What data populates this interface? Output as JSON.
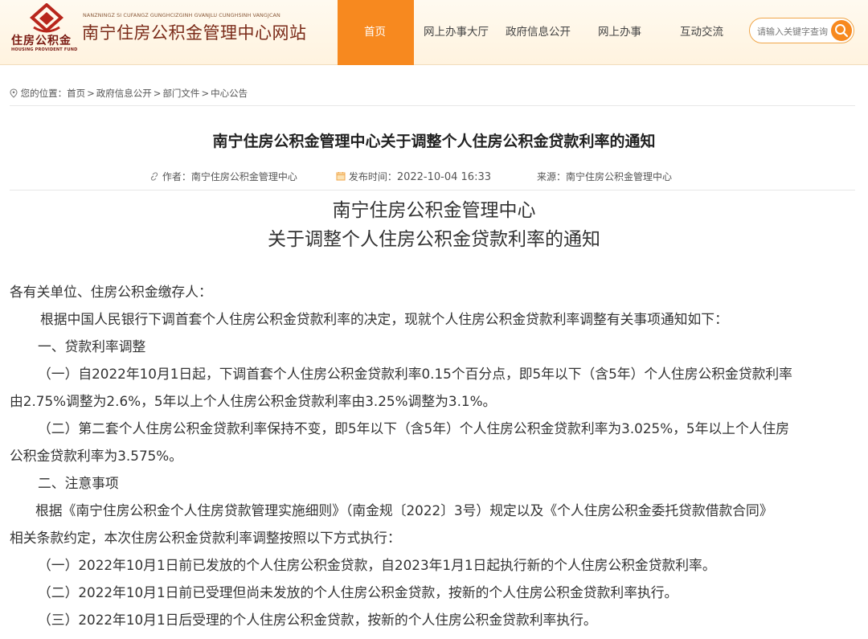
{
  "header": {
    "logo_text_cn": "住房公积金",
    "logo_text_en": "HOUSING PROVIDENT FUND",
    "site_pinyin": "NANZNINGZ SI CUFANGZ GUNGHCIZGINH GVANJLU CUNGHSINH VANGJCAN",
    "site_title": "南宁住房公积金管理中心网站",
    "brand_color": "#7a1a12",
    "accent_color": "#f7891f"
  },
  "nav": {
    "items": [
      {
        "label": "首页"
      },
      {
        "label": "网上办事大厅"
      },
      {
        "label": "政府信息公开"
      },
      {
        "label": "网上办事"
      },
      {
        "label": "互动交流"
      }
    ],
    "active_index": 0
  },
  "search": {
    "placeholder": "请输入关键字查询",
    "icon": "search-icon"
  },
  "breadcrumb": {
    "prefix": "您的位置：",
    "items": [
      "首页",
      "政府信息公开",
      "部门文件",
      "中心公告"
    ],
    "separator": ">"
  },
  "article": {
    "title": "南宁住房公积金管理中心关于调整个人住房公积金贷款利率的通知",
    "author_label": "作者：",
    "author": "南宁住房公积金管理中心",
    "date_label": "发布时间：",
    "date": "2022-10-04 16:33",
    "source_label": "来源：",
    "source": "南宁住房公积金管理中心",
    "heading_line1": "南宁住房公积金管理中心",
    "heading_line2": "关于调整个人住房公积金贷款利率的通知",
    "paragraphs": [
      "各有关单位、住房公积金缴存人：",
      "根据中国人民银行下调首套个人住房公积金贷款利率的决定，现就个人住房公积金贷款利率调整有关事项通知如下：",
      "一、贷款利率调整",
      "（一）自2022年10月1日起，下调首套个人住房公积金贷款利率0.15个百分点，即5年以下（含5年）个人住房公积金贷款利率",
      "由2.75%调整为2.6%，5年以上个人住房公积金贷款利率由3.25%调整为3.1%。",
      "（二）第二套个人住房公积金贷款利率保持不变，即5年以下（含5年）个人住房公积金贷款利率为3.025%，5年以上个人住房",
      "公积金贷款利率为3.575%。",
      "二、注意事项",
      "根据《南宁住房公积金个人住房贷款管理实施细则》（南金规〔2022〕3号）规定以及《个人住房公积金委托贷款借款合同》",
      "相关条款约定，本次住房公积金贷款利率调整按照以下方式执行：",
      "（一）2022年10月1日前已发放的个人住房公积金贷款，自2023年1月1日起执行新的个人住房公积金贷款利率。",
      "（二）2022年10月1日前已受理但尚未发放的个人住房公积金贷款，按新的个人住房公积金贷款利率执行。",
      "（三）2022年10月1日后受理的个人住房公积金贷款，按新的个人住房公积金贷款利率执行。"
    ]
  }
}
